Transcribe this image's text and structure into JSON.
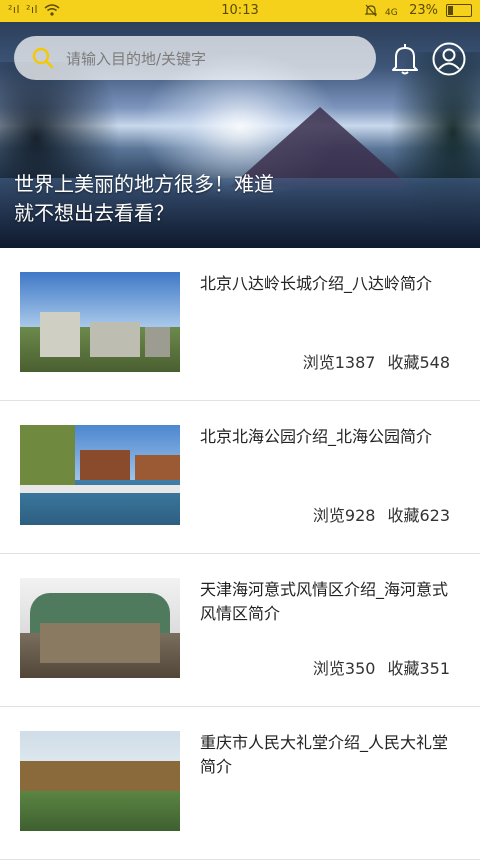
{
  "status_bar": {
    "signal_1": "²ıl",
    "signal_2": "²ıl",
    "time": "10:13",
    "battery": "23%"
  },
  "header": {
    "search": {
      "placeholder": "请输入目的地/关键字"
    },
    "hero_text_line1": "世界上美丽的地方很多！难道",
    "hero_text_line2": "就不想出去看看？"
  },
  "list": [
    {
      "title": "北京八达岭长城介绍_八达岭简介",
      "views_label": "浏览1387",
      "favorites_label": "收藏548"
    },
    {
      "title": "北京北海公园介绍_北海公园简介",
      "views_label": "浏览928",
      "favorites_label": "收藏623"
    },
    {
      "title": "天津海河意式风情区介绍_海河意式风情区简介",
      "views_label": "浏览350",
      "favorites_label": "收藏351"
    },
    {
      "title": "重庆市人民大礼堂介绍_人民大礼堂简介",
      "views_label": "",
      "favorites_label": ""
    }
  ],
  "colors": {
    "status_bar": "#f5d11c",
    "accent": "#f5d11c"
  },
  "icons": [
    "search-icon",
    "bell-icon",
    "user-icon",
    "wifi-icon",
    "battery-icon"
  ]
}
